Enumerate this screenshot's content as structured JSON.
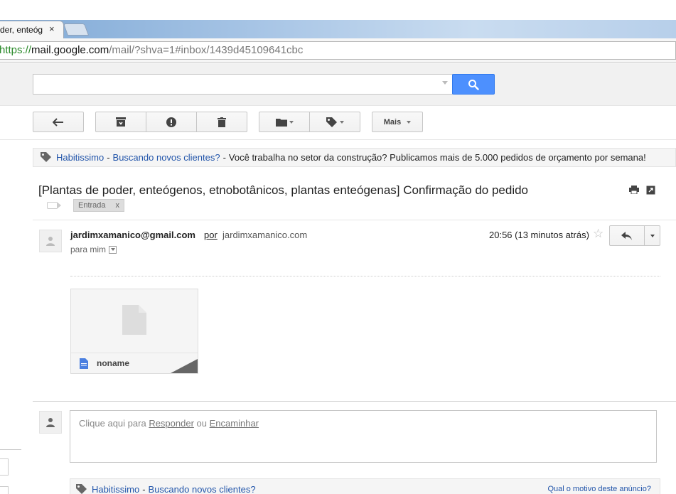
{
  "browser": {
    "tab_title": "der, enteóg",
    "tab_close": "×",
    "url_scheme": "https://",
    "url_host": "mail.google.com",
    "url_path": "/mail/?shva=1#inbox/1439d45109641cbc"
  },
  "toolbar": {
    "more_label": "Mais"
  },
  "ad": {
    "advertiser": "Habitissimo",
    "headline": "Buscando novos clientes?",
    "body": "Você trabalha no setor da construção? Publicamos mais de 5.000 pedidos de orçamento por semana!",
    "dash": "-"
  },
  "message": {
    "subject": "[Plantas de poder, enteógenos, etnobotânicos, plantas enteógenas] Confirmação do pedido",
    "label": "Entrada",
    "label_remove": "x",
    "sender_email": "jardimxamanico@gmail.com",
    "via_label": "por",
    "via_domain": "jardimxamanico.com",
    "to_line": "para mim",
    "timestamp": "20:56 (13 minutos atrás)",
    "star": "☆"
  },
  "attachment": {
    "filename": "noname"
  },
  "reply": {
    "prefix": "Clique aqui para",
    "reply_link": "Responder",
    "or": "ou",
    "forward_link": "Encaminhar"
  },
  "bottom_ad": {
    "advertiser": "Habitissimo",
    "dash": "-",
    "headline": "Buscando novos clientes?",
    "why": "Qual o motivo deste anúncio?"
  },
  "colors": {
    "search_blue": "#4d90fe",
    "link_blue": "#2255aa"
  }
}
